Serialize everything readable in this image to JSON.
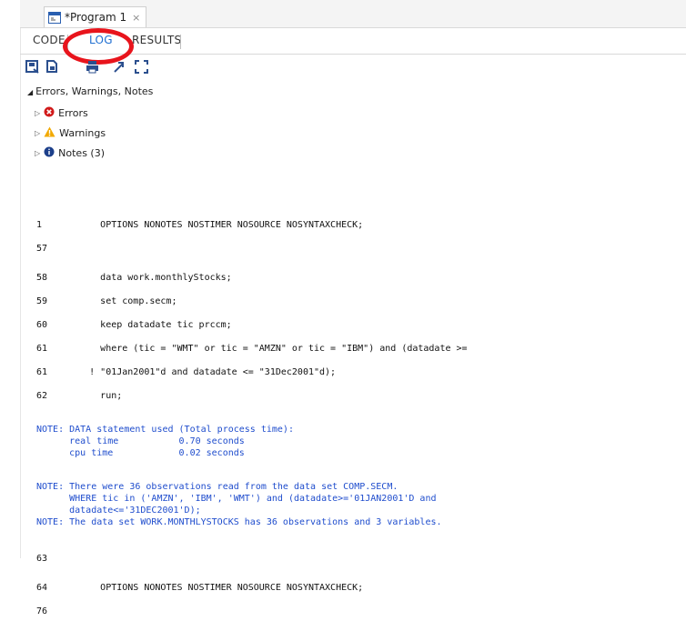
{
  "window": {
    "tab_title": "*Program 1",
    "close_glyph": "×"
  },
  "viewtabs": {
    "code": "CODE",
    "log": "LOG",
    "results": "RESULTS"
  },
  "toolbar": {
    "icons": [
      "save-icon",
      "save-as-icon",
      "print-icon",
      "pop-out-icon",
      "maximize-icon"
    ]
  },
  "section": {
    "title": "Errors, Warnings, Notes",
    "items": [
      {
        "label": "Errors"
      },
      {
        "label": "Warnings"
      },
      {
        "label": "Notes (3)"
      }
    ]
  },
  "log_lines": [
    {
      "num": "1",
      "text": "         OPTIONS NONOTES NOSTIMER NOSOURCE NOSYNTAXCHECK;"
    },
    {
      "num": "57",
      "text": ""
    },
    {
      "num": "58",
      "text": "         data work.monthlyStocks;"
    },
    {
      "num": "59",
      "text": "         set comp.secm;"
    },
    {
      "num": "60",
      "text": "         keep datadate tic prccm;"
    },
    {
      "num": "61",
      "text": "         where (tic = \"WMT\" or tic = \"AMZN\" or tic = \"IBM\") and (datadate >="
    },
    {
      "num": "61",
      "text": "       ! \"01Jan2001\"d and datadate <= \"31Dec2001\"d);"
    },
    {
      "num": "62",
      "text": "         run;"
    }
  ],
  "note1": {
    "l1": "NOTE: DATA statement used (Total process time):",
    "l2": "      real time           0.70 seconds",
    "l3": "      cpu time            0.02 seconds"
  },
  "note2": {
    "l1": "NOTE: There were 36 observations read from the data set COMP.SECM.",
    "l2": "      WHERE tic in ('AMZN', 'IBM', 'WMT') and (datadate>='01JAN2001'D and",
    "l3": "      datadate<='31DEC2001'D);",
    "l4": "NOTE: The data set WORK.MONTHLYSTOCKS has 36 observations and 3 variables."
  },
  "log_lines2": [
    {
      "num": "63",
      "text": ""
    },
    {
      "num": "64",
      "text": "         OPTIONS NONOTES NOSTIMER NOSOURCE NOSYNTAXCHECK;"
    },
    {
      "num": "76",
      "text": ""
    }
  ]
}
